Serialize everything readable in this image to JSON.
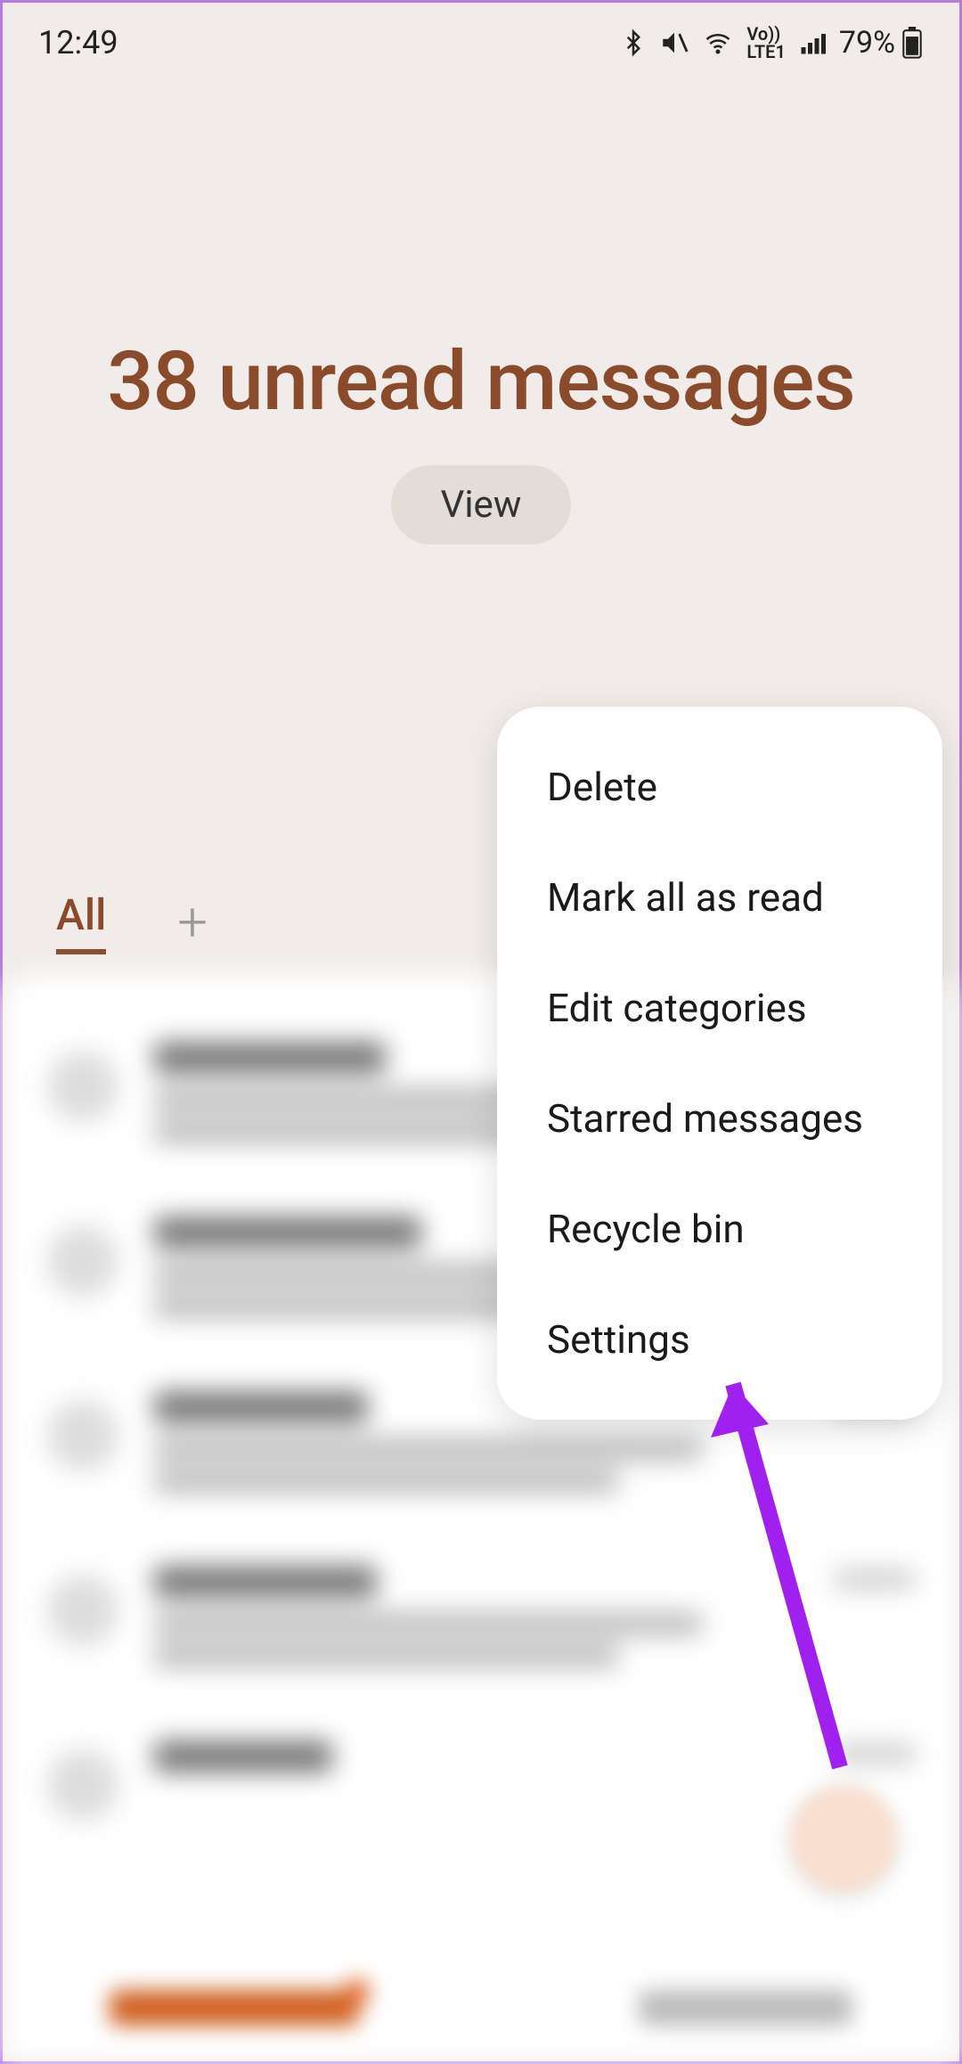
{
  "status": {
    "time": "12:49",
    "battery_pct": "79%",
    "icons": {
      "bluetooth": "bluetooth",
      "mute": "vibrate-mute",
      "wifi": "wifi",
      "volte": "VoLTE1",
      "signal": "signal",
      "battery": "battery"
    }
  },
  "hero": {
    "title": "38 unread messages",
    "view_label": "View"
  },
  "tabs": {
    "all_label": "All",
    "plus_label": "+"
  },
  "menu": {
    "items": [
      "Delete",
      "Mark all as read",
      "Edit categories",
      "Starred messages",
      "Recycle bin",
      "Settings"
    ]
  },
  "colors": {
    "accent": "#8a4a2c",
    "arrow": "#a020f0",
    "bg": "#f1ece9"
  }
}
